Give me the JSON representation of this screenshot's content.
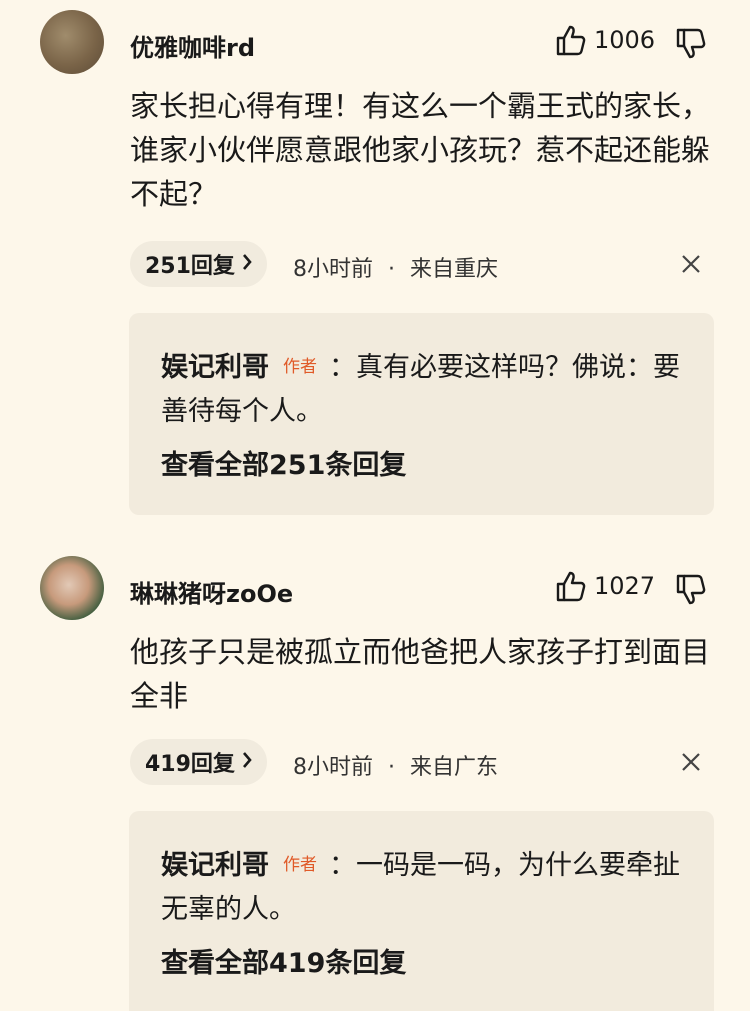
{
  "comments": [
    {
      "username": "优雅咖啡rd",
      "likes": "1006",
      "text": "家长担心得有理！有这么一个霸王式的家长，谁家小伙伴愿意跟他家小孩玩？惹不起还能躲不起？",
      "reply_count_label": "251回复",
      "time": "8小时前",
      "location": "来自重庆",
      "top_reply": {
        "name": "娱记利哥",
        "tag": "作者",
        "text": "：真有必要这样吗？佛说：要善待每个人。",
        "view_all": "查看全部251条回复"
      }
    },
    {
      "username": "琳琳猪呀zoOe",
      "likes": "1027",
      "text": "他孩子只是被孤立而他爸把人家孩子打到面目全非",
      "reply_count_label": "419回复",
      "time": "8小时前",
      "location": "来自广东",
      "top_reply": {
        "name": "娱记利哥",
        "tag": "作者",
        "text": "：一码是一码，为什么要牵扯无辜的人。",
        "view_all": "查看全部419条回复"
      }
    }
  ],
  "meta_separator": "·",
  "icons": {
    "like": "thumbs-up-icon",
    "dislike": "thumbs-down-icon",
    "close": "close-icon",
    "chevron": "chevron-right-icon"
  },
  "colors": {
    "background": "#fdf7ea",
    "author_tag": "#e05a28",
    "reply_box": "#f2ebdd"
  }
}
